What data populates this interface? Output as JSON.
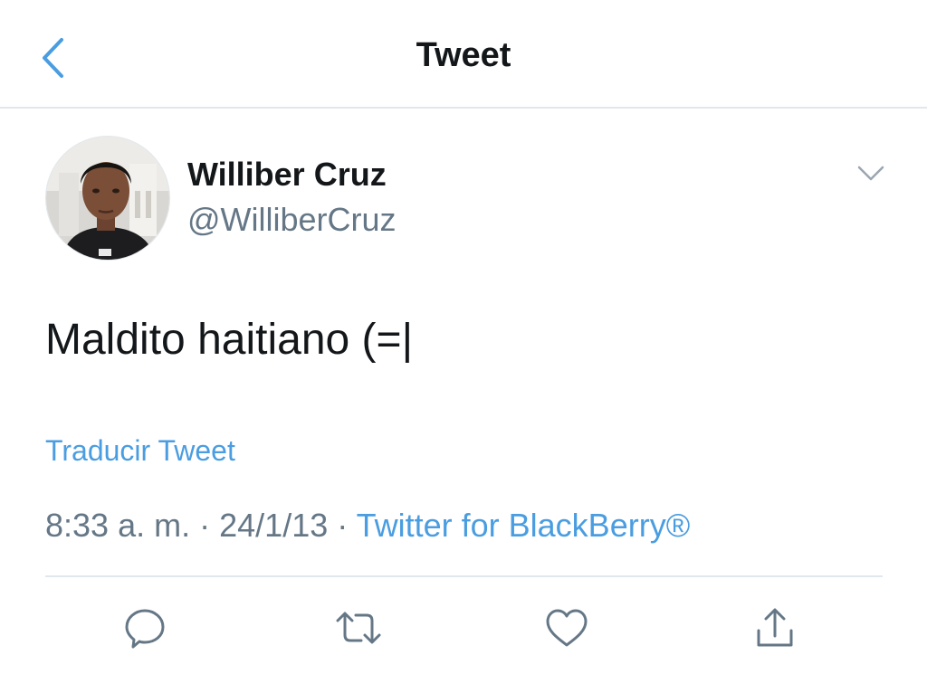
{
  "nav": {
    "title": "Tweet",
    "back_icon": "chevron-left-icon"
  },
  "tweet": {
    "author": {
      "display_name": "Williber Cruz",
      "handle": "@WilliberCruz"
    },
    "text": "Maldito haitiano (=|",
    "translate_label": "Traducir Tweet",
    "time": "8:33 a. m.",
    "separator": "·",
    "date": "24/1/13",
    "source": "Twitter for BlackBerry®"
  },
  "actions": [
    {
      "icon": "reply-icon"
    },
    {
      "icon": "retweet-icon"
    },
    {
      "icon": "like-icon"
    },
    {
      "icon": "share-icon"
    }
  ],
  "colors": {
    "accent": "#4a9de0",
    "text": "#14171a",
    "muted": "#657786",
    "divider": "#e1e8ed"
  }
}
